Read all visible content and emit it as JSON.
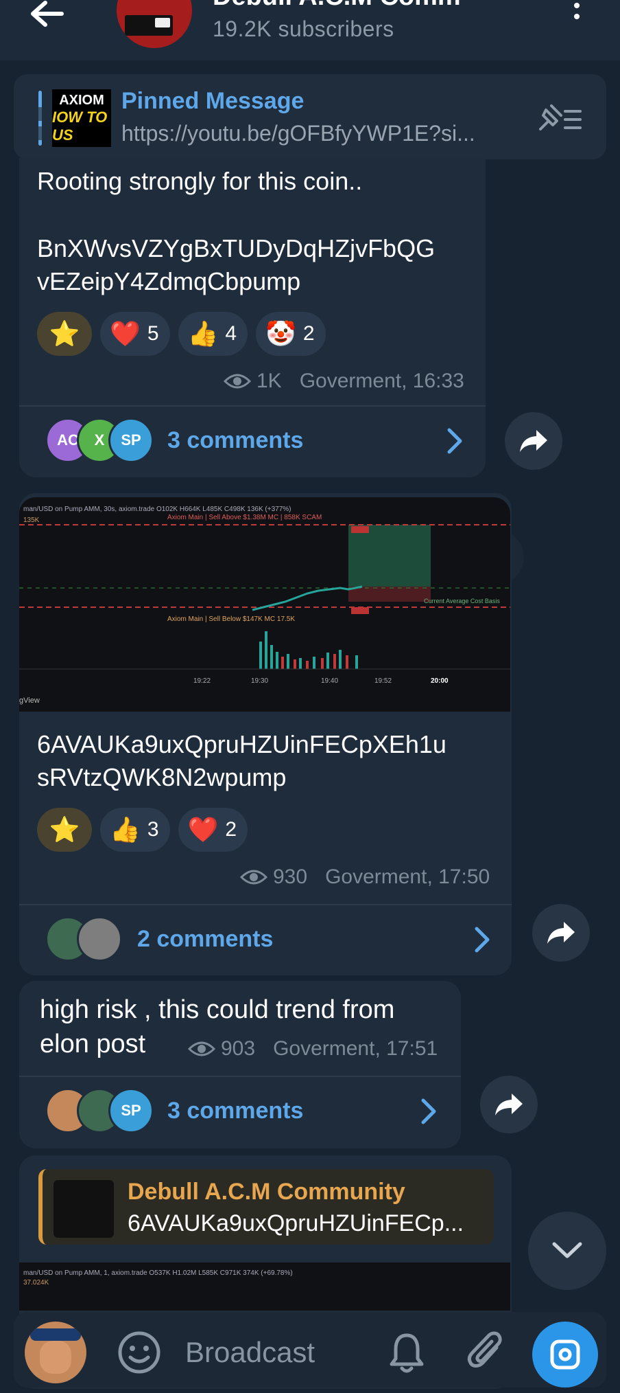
{
  "header": {
    "title": "Debull A.C.M Comm",
    "subscribers": "19.2K subscribers"
  },
  "pinned": {
    "label": "Pinned Message",
    "text": "https://youtu.be/gOFBfyYWP1E?si...",
    "thumb_line1": "AXIOM",
    "thumb_line2": "IOW TO US"
  },
  "messages": [
    {
      "text_lines": [
        "Rooting strongly for this coin..",
        "",
        "BnXWvsVZYgBxTUDyDqHZjvFbQG",
        "vEZeipY4ZdmqCbpump"
      ],
      "reactions": [
        {
          "emoji": "⭐",
          "count": ""
        },
        {
          "emoji": "❤️",
          "count": "5"
        },
        {
          "emoji": "👍",
          "count": "4"
        },
        {
          "emoji": "🤡",
          "count": "2"
        }
      ],
      "views": "1K",
      "author_time": "Goverment, 16:33",
      "avatars": [
        "AC",
        "X",
        "SP"
      ],
      "comments": "3 comments"
    },
    {
      "chart": {
        "header": "man/USD on Pump AMM, 30s, axiom.trade  O102K  H664K  L485K  C498K  136K (+377%)",
        "sub": "135K",
        "label_top": "Axiom Main | Sell Above $1.38M MC | 858K SCAM",
        "label_mid": "Axiom Main | Sell Below $147K MC  17.5K",
        "label_right": "Current Average Cost Basis",
        "cancel": "cancel",
        "times": [
          "19:22",
          "19:30",
          "19:40",
          "19:52",
          "20:00"
        ],
        "footer": "gView"
      },
      "text_lines": [
        "6AVAUKa9uxQpruHZUinFECpXEh1u",
        "sRVtzQWK8N2wpump"
      ],
      "reactions": [
        {
          "emoji": "⭐",
          "count": ""
        },
        {
          "emoji": "👍",
          "count": "3"
        },
        {
          "emoji": "❤️",
          "count": "2"
        }
      ],
      "views": "930",
      "author_time": "Goverment, 17:50",
      "comments": "2 comments"
    },
    {
      "text_lines": [
        "high risk , this could trend from",
        "elon post"
      ],
      "views": "903",
      "author_time": "Goverment, 17:51",
      "avatars": [
        "",
        "",
        "SP"
      ],
      "comments": "3 comments"
    },
    {
      "reply": {
        "title": "Debull A.C.M Community",
        "text": "6AVAUKa9uxQpruHZUinFECp..."
      },
      "chart_header": "man/USD on Pump AMM, 1, axiom.trade  O537K  H1.02M  L585K  C971K  374K (+69.78%)",
      "chart_sub": "37.024K"
    }
  ],
  "input": {
    "placeholder": "Broadcast"
  },
  "colors": {
    "accent": "#5ea8ea",
    "reply_accent": "#e8a64f",
    "camera": "#2b95e8"
  }
}
